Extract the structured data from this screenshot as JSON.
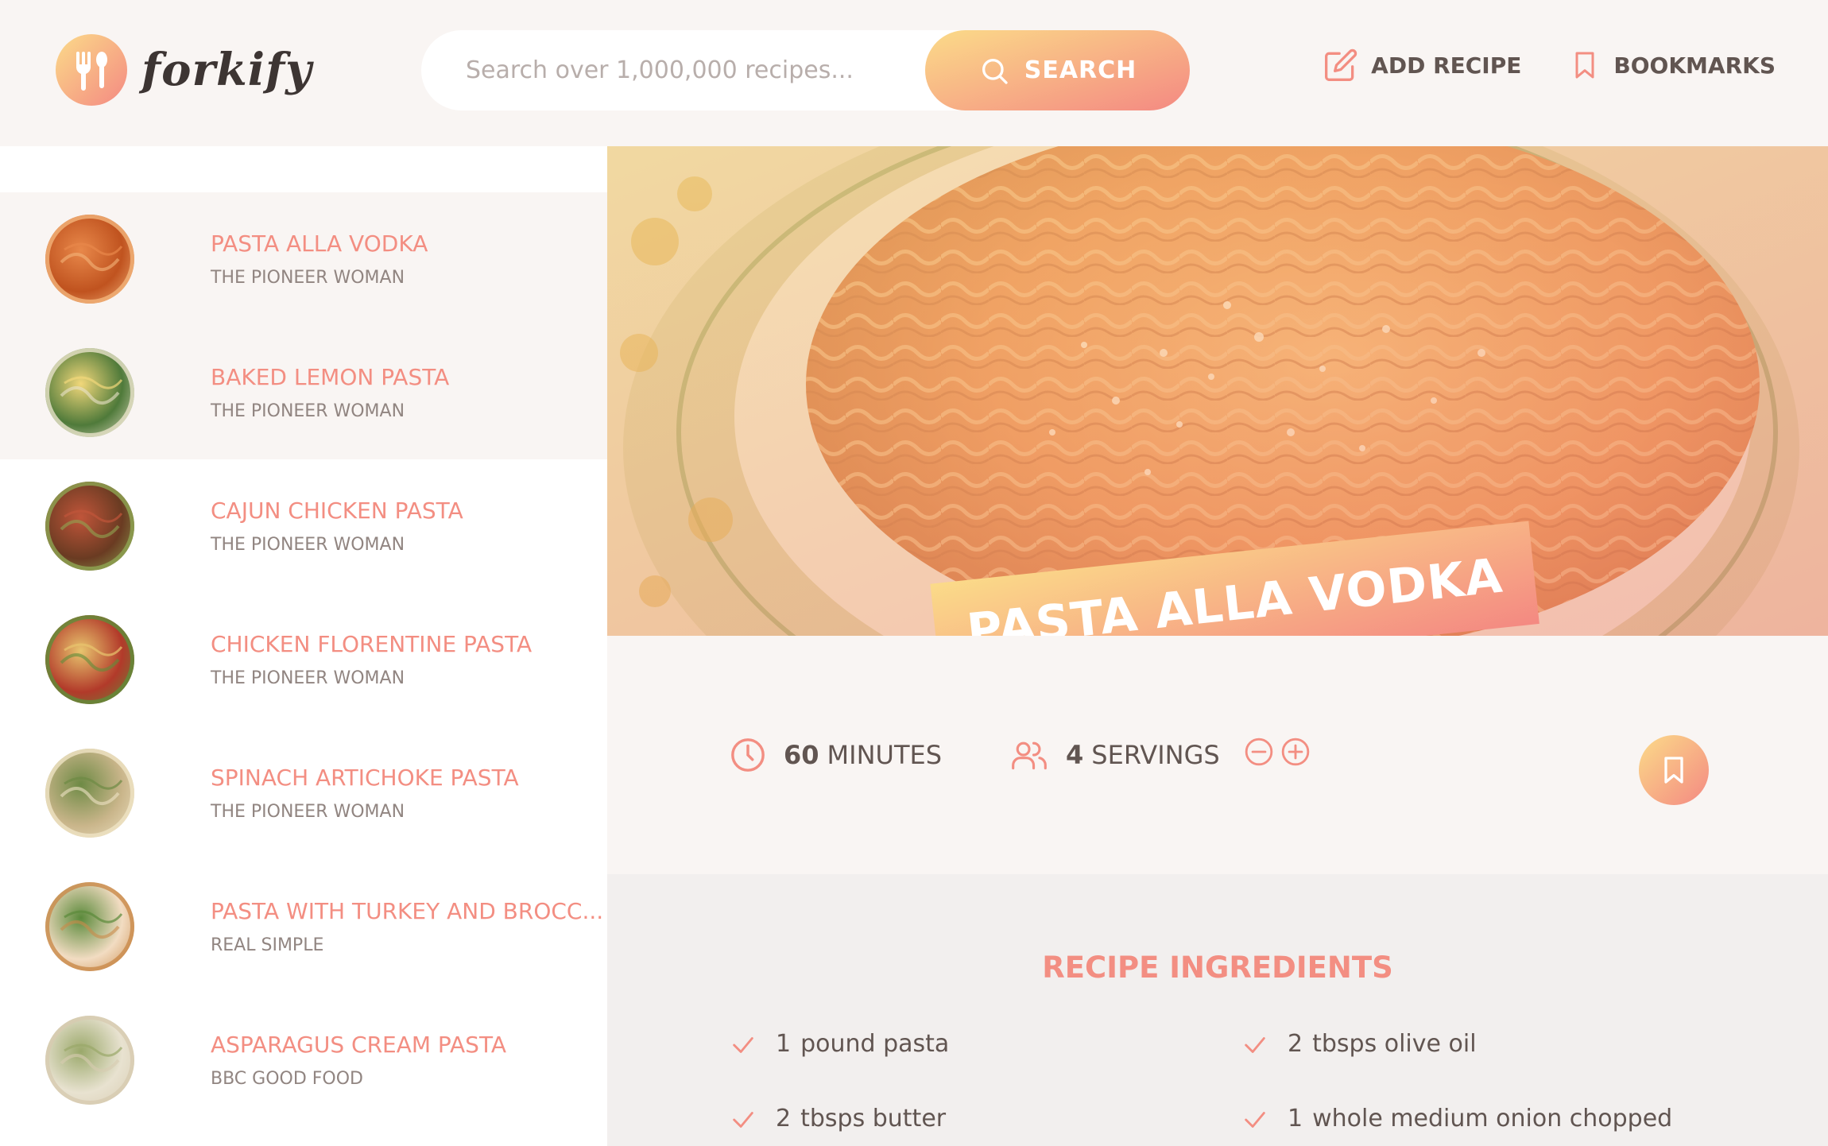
{
  "header": {
    "logo_text": "forkify",
    "search_placeholder": "Search over 1,000,000 recipes...",
    "search_button": "SEARCH",
    "nav": [
      {
        "label": "ADD RECIPE",
        "icon": "edit-icon"
      },
      {
        "label": "BOOKMARKS",
        "icon": "bookmark-icon"
      }
    ]
  },
  "results": [
    {
      "title": "PASTA ALLA VODKA",
      "publisher": "THE PIONEER WOMAN",
      "active": true
    },
    {
      "title": "BAKED LEMON PASTA",
      "publisher": "THE PIONEER WOMAN",
      "active": true
    },
    {
      "title": "CAJUN CHICKEN PASTA",
      "publisher": "THE PIONEER WOMAN",
      "active": false
    },
    {
      "title": "CHICKEN FLORENTINE PASTA",
      "publisher": "THE PIONEER WOMAN",
      "active": false
    },
    {
      "title": "SPINACH ARTICHOKE PASTA",
      "publisher": "THE PIONEER WOMAN",
      "active": false
    },
    {
      "title": "PASTA WITH TURKEY AND BROCC...",
      "publisher": "REAL SIMPLE",
      "active": false
    },
    {
      "title": "ASPARAGUS CREAM PASTA",
      "publisher": "BBC GOOD FOOD",
      "active": false
    }
  ],
  "recipe": {
    "title": "PASTA ALLA VODKA",
    "cooking_time": "60",
    "cooking_time_unit": "MINUTES",
    "servings": "4",
    "servings_unit": "SERVINGS",
    "ingredients_heading": "RECIPE INGREDIENTS",
    "ingredients": [
      {
        "qty": "1",
        "desc": "pound pasta"
      },
      {
        "qty": "2",
        "desc": "tbsps olive oil"
      },
      {
        "qty": "2",
        "desc": "tbsps butter"
      },
      {
        "qty": "1",
        "desc": "whole medium onion chopped"
      }
    ]
  },
  "colors": {
    "accent": "#f38e82",
    "gradient_start": "#fbdb89",
    "gradient_end": "#f48982",
    "text": "#615551",
    "bg": "#f9f5f3"
  }
}
